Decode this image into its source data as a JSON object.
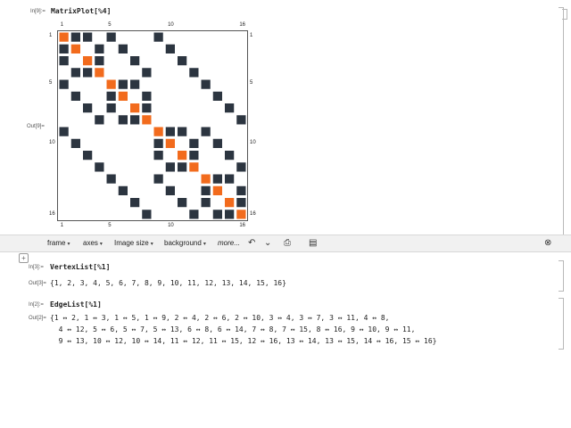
{
  "cells": [
    {
      "in_label": "In[9]:=",
      "input": "MatrixPlot[%4]",
      "out_label": "Out[9]="
    },
    {
      "in_label": "In[3]:=",
      "input": "VertexList[%1]",
      "out_label": "Out[3]=",
      "output_lines": [
        "{1, 2, 3, 4, 5, 6, 7, 8, 9, 10, 11, 12, 13, 14, 15, 16}"
      ]
    },
    {
      "in_label": "In[2]:=",
      "input": "EdgeList[%1]",
      "out_label": "Out[2]=",
      "output_lines": [
        "{1 ↔ 2, 1 ↔ 3, 1 ↔ 5, 1 ↔ 9, 2 ↔ 4, 2 ↔ 6, 2 ↔ 10, 3 ↔ 4, 3 ↔ 7, 3 ↔ 11, 4 ↔ 8,",
        "  4 ↔ 12, 5 ↔ 6, 5 ↔ 7, 5 ↔ 13, 6 ↔ 8, 6 ↔ 14, 7 ↔ 8, 7 ↔ 15, 8 ↔ 16, 9 ↔ 10, 9 ↔ 11,",
        "  9 ↔ 13, 10 ↔ 12, 10 ↔ 14, 11 ↔ 12, 11 ↔ 15, 12 ↔ 16, 13 ↔ 14, 13 ↔ 15, 14 ↔ 16, 15 ↔ 16}"
      ]
    }
  ],
  "plot": {
    "size": 16,
    "ticks": [
      "1",
      "5",
      "10",
      "16"
    ],
    "tick_values": [
      1,
      5,
      10,
      16
    ],
    "colors": {
      "diagonal": "#f26b1d",
      "edge": "#2c3540",
      "frame": "#555555"
    },
    "edges": [
      [
        1,
        2
      ],
      [
        1,
        3
      ],
      [
        1,
        5
      ],
      [
        1,
        9
      ],
      [
        2,
        4
      ],
      [
        2,
        6
      ],
      [
        2,
        10
      ],
      [
        3,
        4
      ],
      [
        3,
        7
      ],
      [
        3,
        11
      ],
      [
        4,
        8
      ],
      [
        4,
        12
      ],
      [
        5,
        6
      ],
      [
        5,
        7
      ],
      [
        5,
        13
      ],
      [
        6,
        8
      ],
      [
        6,
        14
      ],
      [
        7,
        8
      ],
      [
        7,
        15
      ],
      [
        8,
        16
      ],
      [
        9,
        10
      ],
      [
        9,
        11
      ],
      [
        9,
        13
      ],
      [
        10,
        12
      ],
      [
        10,
        14
      ],
      [
        11,
        12
      ],
      [
        11,
        15
      ],
      [
        12,
        16
      ],
      [
        13,
        14
      ],
      [
        13,
        15
      ],
      [
        14,
        16
      ],
      [
        15,
        16
      ]
    ]
  },
  "toolbar": {
    "frame": "frame",
    "axes": "axes",
    "image_size": "Image size",
    "background": "background",
    "more": "more..."
  }
}
